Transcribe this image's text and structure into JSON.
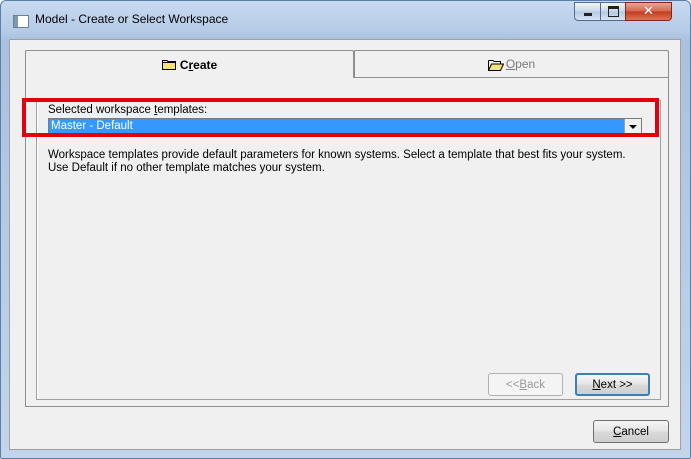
{
  "window": {
    "title": "Model - Create or Select Workspace"
  },
  "tabs": {
    "create": {
      "label_prefix": "C",
      "label_accel": "r",
      "label_rest": "eate",
      "icon": "folder-icon",
      "active": true
    },
    "open": {
      "label_accel": "O",
      "label_rest": "pen",
      "icon": "open-folder-icon",
      "active": false
    }
  },
  "create_panel": {
    "templates_label_prefix": "Selected workspace ",
    "templates_label_accel": "t",
    "templates_label_rest": "emplates:",
    "selected_template": "Master - Default",
    "description": "Workspace templates provide default parameters for known systems. Select a template that best fits your system. Use Default if no other template matches your system.",
    "highlight_color": "#e3000b",
    "selection_color": "#3399ff"
  },
  "buttons": {
    "back": {
      "prefix": "<< ",
      "accel": "B",
      "rest": "ack",
      "enabled": false
    },
    "next": {
      "accel": "N",
      "rest": "ext >>",
      "enabled": true
    },
    "cancel": {
      "accel": "C",
      "rest": "ancel"
    }
  }
}
